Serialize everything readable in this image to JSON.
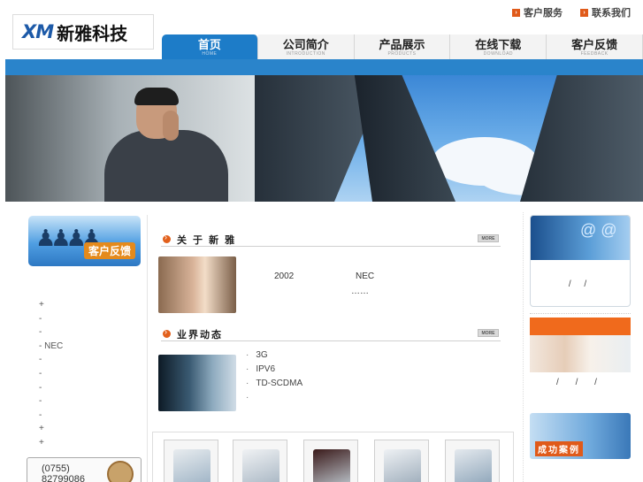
{
  "header": {
    "logo_mark": "XM",
    "logo_name": "新雅科技",
    "top_links": [
      {
        "label": "客户服务"
      },
      {
        "label": "联系我们"
      }
    ]
  },
  "nav": {
    "items": [
      {
        "label": "首页",
        "sub": "HOME",
        "active": true
      },
      {
        "label": "公司简介",
        "sub": "INTRODUCTION"
      },
      {
        "label": "产品展示",
        "sub": "PRODUCTS"
      },
      {
        "label": "在线下载",
        "sub": "DOWNLOAD"
      },
      {
        "label": "客户反馈",
        "sub": "FEEDBACK"
      }
    ]
  },
  "left": {
    "feedback_banner": "客户反馈",
    "list": [
      "+",
      "-",
      "-",
      "- NEC",
      "-",
      "-",
      "-",
      "-",
      "-",
      "+",
      "+"
    ],
    "contact_area": "(0755)",
    "contact_number": "82799086"
  },
  "about": {
    "title": "关 于 新 雅",
    "more": "MORE",
    "text_year": "2002",
    "text_brand": "NEC",
    "ellipsis": "……"
  },
  "news": {
    "title": "业界动态",
    "more": "MORE",
    "items": [
      {
        "bullet": "·",
        "text": "3G"
      },
      {
        "bullet": "·",
        "text": "IPV6"
      },
      {
        "bullet": "·",
        "text": "TD-SCDMA"
      },
      {
        "bullet": "·",
        "text": ""
      }
    ]
  },
  "right": {
    "box1_symbols": "@ @",
    "box1_text": "/ /",
    "box2_text": "/ / /",
    "box3_label": "成功案例"
  }
}
